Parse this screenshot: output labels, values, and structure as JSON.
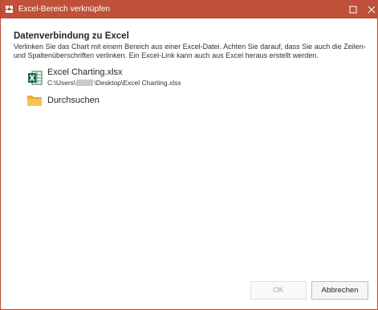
{
  "window": {
    "title": "Excel-Bereich verknüpfen",
    "accent_color": "#c0503a",
    "maximize_icon": "maximize-icon",
    "close_icon": "close-icon"
  },
  "content": {
    "heading": "Datenverbindung zu Excel",
    "description": "Verlinken Sie das Chart mit einem Bereich aus einer Excel-Datei. Achten Sie darauf, dass Sie auch die Zeilen- und Spaltenüberschriften verlinken. Ein Excel-Link kann auch aus Excel heraus erstellt werden."
  },
  "recent_file": {
    "icon": "excel-icon",
    "name": "Excel Charting.xlsx",
    "path_prefix": "C:\\Users\\",
    "path_suffix": "\\Desktop\\Excel Charting.xlsx"
  },
  "browse": {
    "icon": "folder-icon",
    "label": "Durchsuchen"
  },
  "buttons": {
    "ok": "OK",
    "cancel": "Abbrechen"
  }
}
